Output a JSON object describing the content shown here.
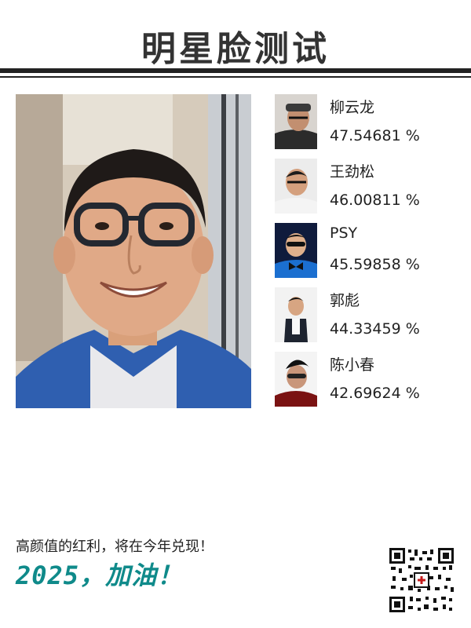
{
  "title": "明星脸测试",
  "results": [
    {
      "name": "柳云龙",
      "score": "47.54681 %"
    },
    {
      "name": "王劲松",
      "score": "46.00811 %"
    },
    {
      "name": "PSY",
      "score": "45.59858 %"
    },
    {
      "name": "郭彪",
      "score": "44.33459 %"
    },
    {
      "name": "陈小春",
      "score": "42.69624 %"
    }
  ],
  "footer": {
    "slogan": "高颜值的红利，将在今年兑现！",
    "cheer": "2025，加油！"
  },
  "colors": {
    "accent": "#0f8a8a",
    "rule": "#222222"
  },
  "icons": {
    "qr": "qr-code-icon"
  }
}
